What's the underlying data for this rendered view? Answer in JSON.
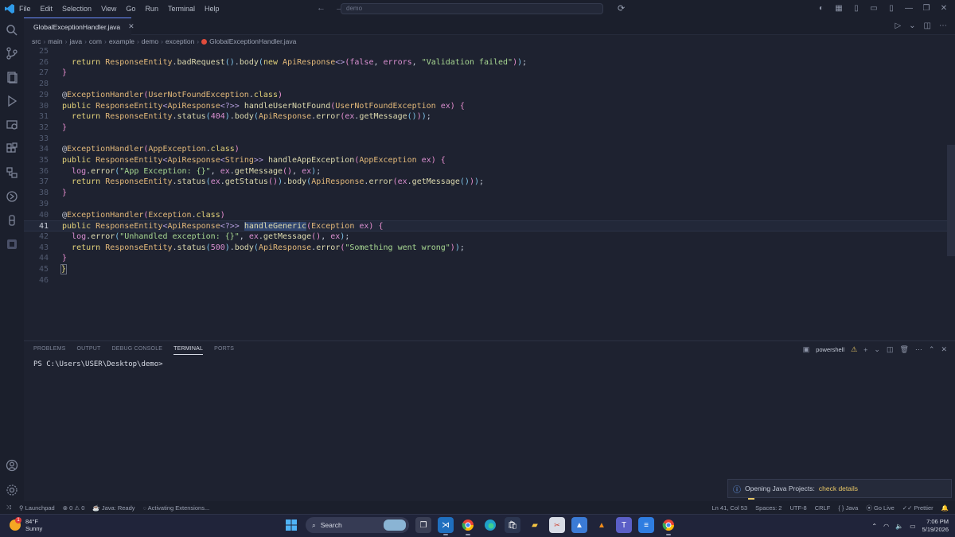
{
  "titlebar": {
    "menu": [
      "File",
      "Edit",
      "Selection",
      "View",
      "Go",
      "Run",
      "Terminal",
      "Help"
    ],
    "command_center": "demo"
  },
  "editor": {
    "tab_label": "GlobalExceptionHandler.java",
    "breadcrumb": [
      "src",
      "main",
      "java",
      "com",
      "example",
      "demo",
      "exception",
      "GlobalExceptionHandler.java"
    ],
    "line_numbers": [
      "25",
      "26",
      "27",
      "28",
      "29",
      "30",
      "31",
      "32",
      "33",
      "34",
      "35",
      "36",
      "37",
      "38",
      "39",
      "40",
      "41",
      "42",
      "43",
      "44",
      "45",
      "46"
    ],
    "active_line": "41"
  },
  "panel": {
    "tabs": [
      "PROBLEMS",
      "OUTPUT",
      "DEBUG CONSOLE",
      "TERMINAL",
      "PORTS"
    ],
    "active_tab": "TERMINAL",
    "shell": "powershell",
    "prompt": "PS C:\\Users\\USER\\Desktop\\demo>"
  },
  "notification": {
    "text": "Opening Java Projects:",
    "link": "check details"
  },
  "statusbar": {
    "launchpad": "Launchpad",
    "errors": "0",
    "warnings": "0",
    "java_status": "Java: Ready",
    "activity": "Activating Extensions...",
    "position": "Ln 41, Col 53",
    "spaces": "Spaces: 2",
    "encoding": "UTF-8",
    "eol": "CRLF",
    "language": "Java",
    "golive": "Go Live",
    "prettier": "Prettier"
  },
  "taskbar": {
    "temperature": "84°F",
    "condition": "Sunny",
    "weather_badge": "1",
    "search_label": "Search",
    "time": "7:06 PM",
    "date": "5/19/2026"
  }
}
